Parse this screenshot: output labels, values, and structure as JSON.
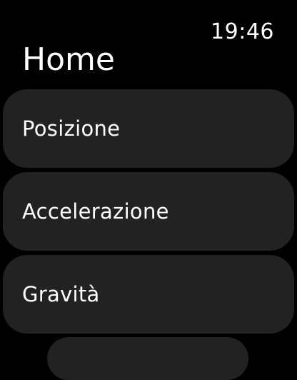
{
  "status": {
    "time": "19:46"
  },
  "header": {
    "title": "Home"
  },
  "menu": {
    "items": [
      {
        "label": "Posizione"
      },
      {
        "label": "Accelerazione"
      },
      {
        "label": "Gravità"
      }
    ]
  },
  "colors": {
    "background": "#000000",
    "card": "#222222",
    "text": "#ffffff"
  }
}
